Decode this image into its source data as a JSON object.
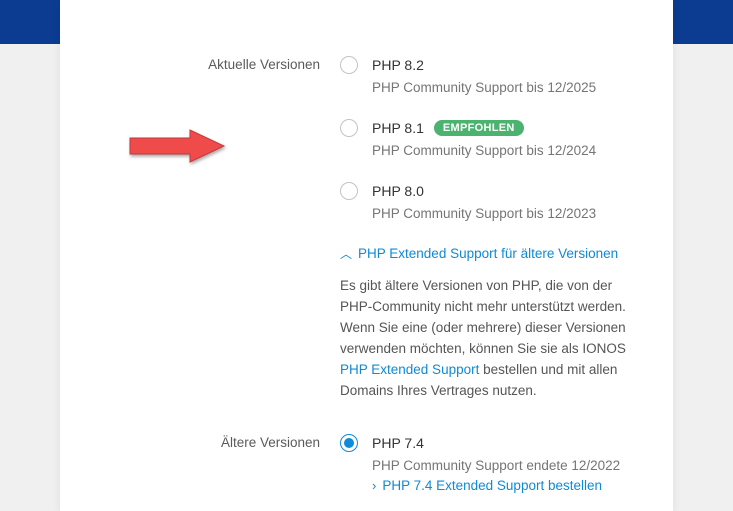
{
  "sections": {
    "current": {
      "label": "Aktuelle Versionen",
      "options": [
        {
          "name": "PHP 8.2",
          "sub": "PHP Community Support bis 12/2025",
          "recommended": false,
          "selected": false
        },
        {
          "name": "PHP 8.1",
          "sub": "PHP Community Support bis 12/2024",
          "recommended": true,
          "selected": false
        },
        {
          "name": "PHP 8.0",
          "sub": "PHP Community Support bis 12/2023",
          "recommended": false,
          "selected": false
        }
      ]
    },
    "older": {
      "label": "Ältere Versionen",
      "options": [
        {
          "name": "PHP 7.4",
          "sub": "PHP Community Support endete 12/2022",
          "selected": true,
          "orderText": "PHP 7.4 Extended Support bestellen"
        }
      ]
    }
  },
  "badge": {
    "recommended": "EMPFOHLEN"
  },
  "expander": {
    "label": "PHP Extended Support für ältere Versionen"
  },
  "info": {
    "text1": "Es gibt ältere Versionen von PHP, die von der PHP-Community nicht mehr unterstützt werden. Wenn Sie eine (oder mehrere) dieser Versionen verwenden möchten, können Sie sie als IONOS ",
    "linkText": "PHP Extended Support",
    "text2": " bestellen und mit allen Domains Ihres Vertrages nutzen."
  }
}
